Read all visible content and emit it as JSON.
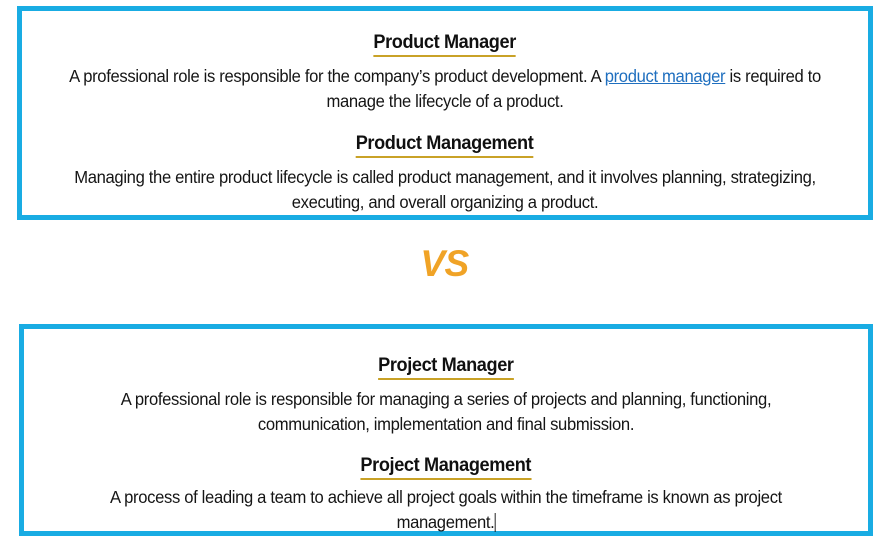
{
  "theme": {
    "box_border_color": "#19ACE3",
    "heading_underline_color": "#C9A227",
    "vs_color": "#F0A326",
    "link_color": "#1F6FBF",
    "text_color": "#151515",
    "background_color": "#FFFFFF"
  },
  "comparison": {
    "separator_label": "VS",
    "top_box": {
      "entries": [
        {
          "heading": "Product Manager",
          "body_before_link": "A professional role is responsible for the company’s product development. A ",
          "link_text": "product manager",
          "body_after_link": " is required to manage the lifecycle of a product."
        },
        {
          "heading": "Product Management",
          "body": "Managing the entire product lifecycle is called product management, and it involves planning, strategizing, executing, and overall organizing a product."
        }
      ]
    },
    "bottom_box": {
      "entries": [
        {
          "heading": "Project Manager",
          "body": "A professional role is responsible for managing a series of projects and planning, functioning, communication, implementation and final submission."
        },
        {
          "heading": "Project Management",
          "body": "A process of leading a team to achieve all project goals within the timeframe is known as project management."
        }
      ]
    }
  }
}
